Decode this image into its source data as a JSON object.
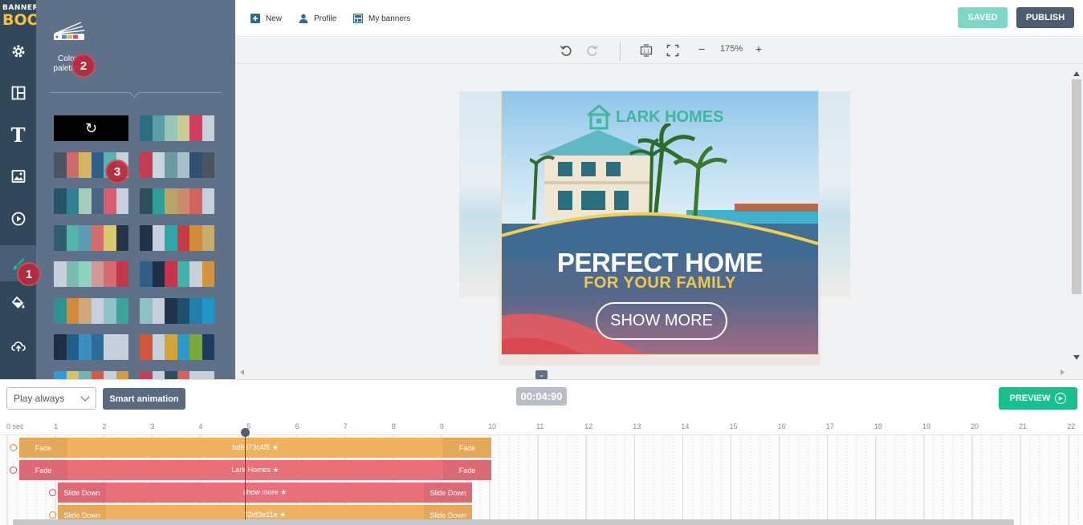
{
  "logo": {
    "line1": "BANNER",
    "line2": "BOO"
  },
  "rail": {
    "items": [
      {
        "name": "settings"
      },
      {
        "name": "layouts"
      },
      {
        "name": "text",
        "glyph": "T"
      },
      {
        "name": "images"
      },
      {
        "name": "media"
      },
      {
        "name": "brush",
        "active": true
      },
      {
        "name": "fill"
      },
      {
        "name": "upload"
      }
    ]
  },
  "panel": {
    "section_label": "Color palettes",
    "palettes": [
      [
        "#2e6c86",
        "#5a9fa6",
        "#9ac4b7",
        "#c7cc96",
        "#d23b62",
        "#c8d0dc"
      ],
      [
        "#4b5460",
        "#d06a6d",
        "#d5b65f",
        "#2f5f87",
        "#56b3ad",
        "#c8d0dc"
      ],
      [
        "#c43b54",
        "#c6d7de",
        "#6d9ba5",
        "#a8c1c9",
        "#31506f",
        "#4b5460"
      ],
      [
        "#255468",
        "#2f8292",
        "#a5cdb9",
        "#4a6481",
        "#d75e72",
        "#c8d0dc"
      ],
      [
        "#2f4e5c",
        "#2f9e96",
        "#b9a566",
        "#c98c6d",
        "#d36361",
        "#c8d0dc"
      ],
      [
        "#2f5f6c",
        "#53b4a9",
        "#5b9bb4",
        "#d56c6c",
        "#d8ca6e",
        "#263349"
      ],
      [
        "#1f3248",
        "#c8d0dc",
        "#2fa6a8",
        "#c83a46",
        "#d38a39",
        "#c6ad6f"
      ],
      [
        "#c8d0dc",
        "#7bbbb1",
        "#8ed2c0",
        "#d09a9a",
        "#d86a74",
        "#c4364a"
      ],
      [
        "#2f5f86",
        "#1e2e45",
        "#c8334b",
        "#3fb2a9",
        "#c8d0dc",
        "#d5933d"
      ],
      [
        "#31918f",
        "#d48a3a",
        "#cfa979",
        "#c8d0dc",
        "#8ec4c8",
        "#3aa59a"
      ],
      [
        "#8fc1c4",
        "#c8d0dc",
        "#20354b",
        "#1e4f6f",
        "#247ea6",
        "#1e96c8"
      ],
      [
        "#1e2e45",
        "#205f8c",
        "#3a8fc0",
        "#2d6c97",
        "#c8d0dc",
        "#c8d0dc"
      ],
      [
        "#d0573b",
        "#c8d0dc",
        "#d5a436",
        "#2a9ad0",
        "#7aa83a",
        "#1e3d5e"
      ],
      [
        "#3498db",
        "#d6c163",
        "#73b3ad",
        "#cf5b49",
        "#c8d0dc",
        "#d59b3d"
      ],
      [
        "#c44058",
        "#c8d0dc",
        "#2f4e5c",
        "#d36361",
        "#c8d0dc",
        "#c8d0dc"
      ]
    ],
    "reset_glyph": "↻"
  },
  "badges": [
    "1",
    "2",
    "3"
  ],
  "topbar": {
    "new_label": "New",
    "profile_label": "Profile",
    "my_banners_label": "My banners",
    "saved_label": "SAVED",
    "publish_label": "PUBLISH"
  },
  "canvas_tools": {
    "zoom": "175%",
    "minus": "−",
    "plus": "+"
  },
  "banner": {
    "brand": "LARK HOMES",
    "headline": "PERFECT HOME",
    "subline": "FOR YOUR FAMILY",
    "cta": "SHOW MORE"
  },
  "timeline_controls": {
    "play_mode": "Play always",
    "smart_animation_label": "Smart animation",
    "time": "00:04:90",
    "preview_label": "PREVIEW"
  },
  "timeline": {
    "ruler_labels": [
      "0 sec",
      "1",
      "2",
      "3",
      "4",
      "5",
      "6",
      "7",
      "8",
      "9",
      "10",
      "11",
      "12",
      "13",
      "14",
      "15",
      "16",
      "17",
      "18",
      "19",
      "20",
      "21",
      "22"
    ],
    "tracks": [
      {
        "start_label": "Fade",
        "name": "bd6673c4f5 ★",
        "end_label": "Fade",
        "color": "#f0b25e"
      },
      {
        "start_label": "Fade",
        "name": "Lark Homes ★",
        "end_label": "Fade",
        "color": "#e8707b"
      },
      {
        "start_label": "Slide Down",
        "name": "show more ★",
        "end_label": "Slide Down",
        "color": "#e8707b"
      },
      {
        "start_label": "Slide Down",
        "name": "32df3e11e ★",
        "end_label": "Slide Down",
        "color": "#f0b25e"
      }
    ]
  }
}
